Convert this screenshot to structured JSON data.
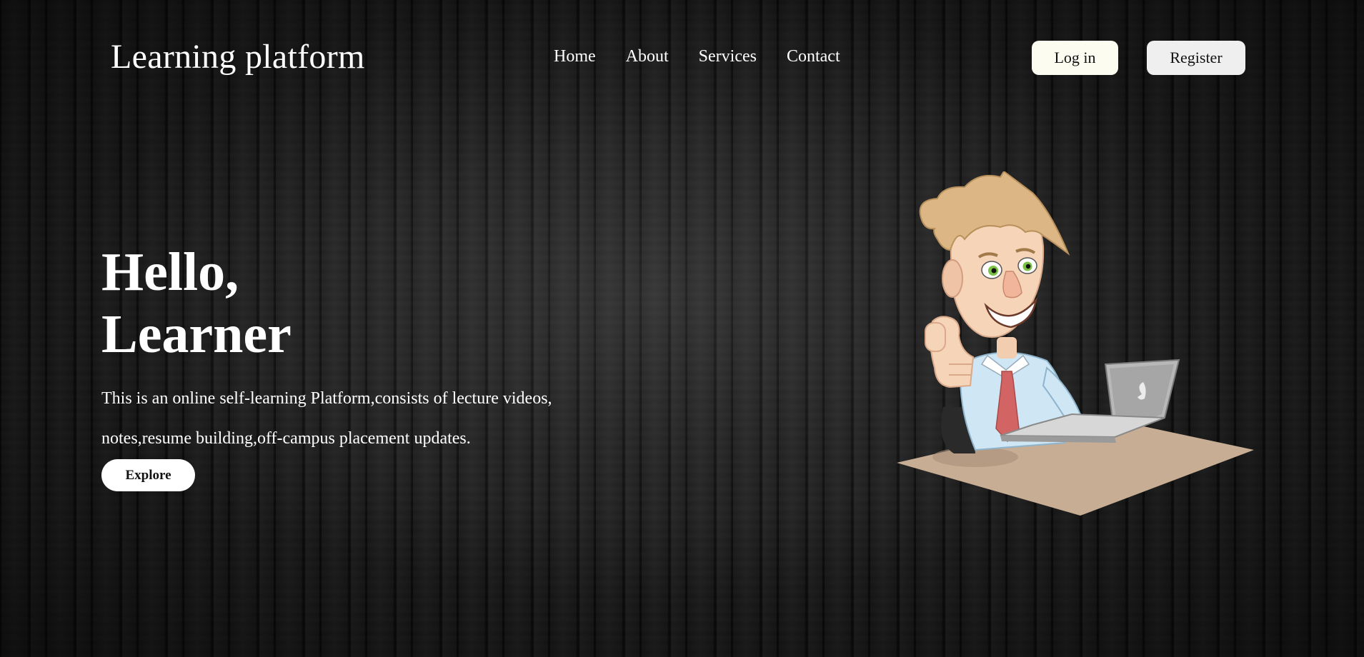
{
  "header": {
    "brand": "Learning platform",
    "nav": [
      "Home",
      "About",
      "Services",
      "Contact"
    ],
    "login_label": "Log in",
    "register_label": "Register"
  },
  "hero": {
    "title_line1": "Hello,",
    "title_line2": "Learner",
    "description": "This is an online self-learning Platform,consists of lecture videos, notes,resume building,off-campus placement updates.",
    "explore_label": "Explore"
  },
  "illustration": {
    "subject": "cartoon man with thumbs up at laptop"
  }
}
